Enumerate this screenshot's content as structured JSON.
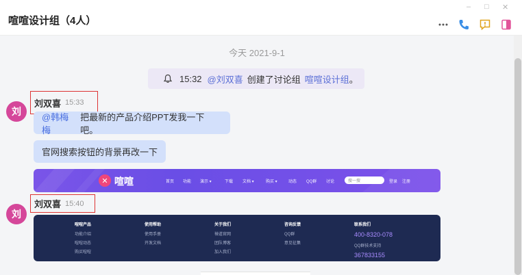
{
  "window": {
    "title": "喧喧设计组（4人）",
    "controls": {
      "minimize": "–",
      "maximize": "□",
      "close": "✕"
    },
    "actions": [
      {
        "icon": "more-icon"
      },
      {
        "icon": "phone-icon",
        "color": "#3a8ee6"
      },
      {
        "icon": "chat-alert-icon",
        "color": "#e0a21b"
      },
      {
        "icon": "sidebar-toggle-icon",
        "color": "#e2559a"
      }
    ]
  },
  "chat": {
    "date_divider": "今天 2021-9-1",
    "notice": {
      "time": "15:32",
      "mention": "@刘双喜",
      "text": "创建了讨论组",
      "group": "喧喧设计组",
      "end": "。"
    },
    "messages": [
      {
        "avatar": "刘",
        "avatar_color": "#d5479a",
        "sender": "刘双喜",
        "time": "15:33",
        "bubbles": [
          {
            "mention": "@韩梅梅",
            "text": "把最新的产品介绍PPT发我一下吧。"
          },
          {
            "mention": "",
            "text": "官网搜索按钮的背景再改一下"
          }
        ],
        "image": {
          "kind": "website-header",
          "logo_mark": "✕",
          "logo_text": "喧喧",
          "nav": [
            "首页",
            "功能",
            "演示 ▾",
            "下载",
            "文档 ▾",
            "购买 ▾",
            "动态",
            "QQ群",
            "讨论"
          ],
          "search_placeholder": "搜一搜",
          "login": "登录",
          "register": "注册"
        }
      },
      {
        "avatar": "刘",
        "avatar_color": "#d5479a",
        "sender": "刘双喜",
        "time": "15:40",
        "image": {
          "kind": "website-footer",
          "columns": [
            {
              "heading": "喧喧产品",
              "links": [
                "功能介绍",
                "喧喧动态",
                "购买喧喧"
              ]
            },
            {
              "heading": "使用帮助",
              "links": [
                "使用手册",
                "开发文档"
              ]
            },
            {
              "heading": "关于我们",
              "links": [
                "禅道官网",
                "团队博客",
                "加入我们"
              ]
            },
            {
              "heading": "咨询反馈",
              "links": [
                "QQ群",
                "意见征集"
              ]
            },
            {
              "heading": "联系我们",
              "phone": "400-8320-078",
              "links": [
                "QQ群技术支持"
              ],
              "qq": "367833155"
            }
          ]
        }
      }
    ]
  }
}
